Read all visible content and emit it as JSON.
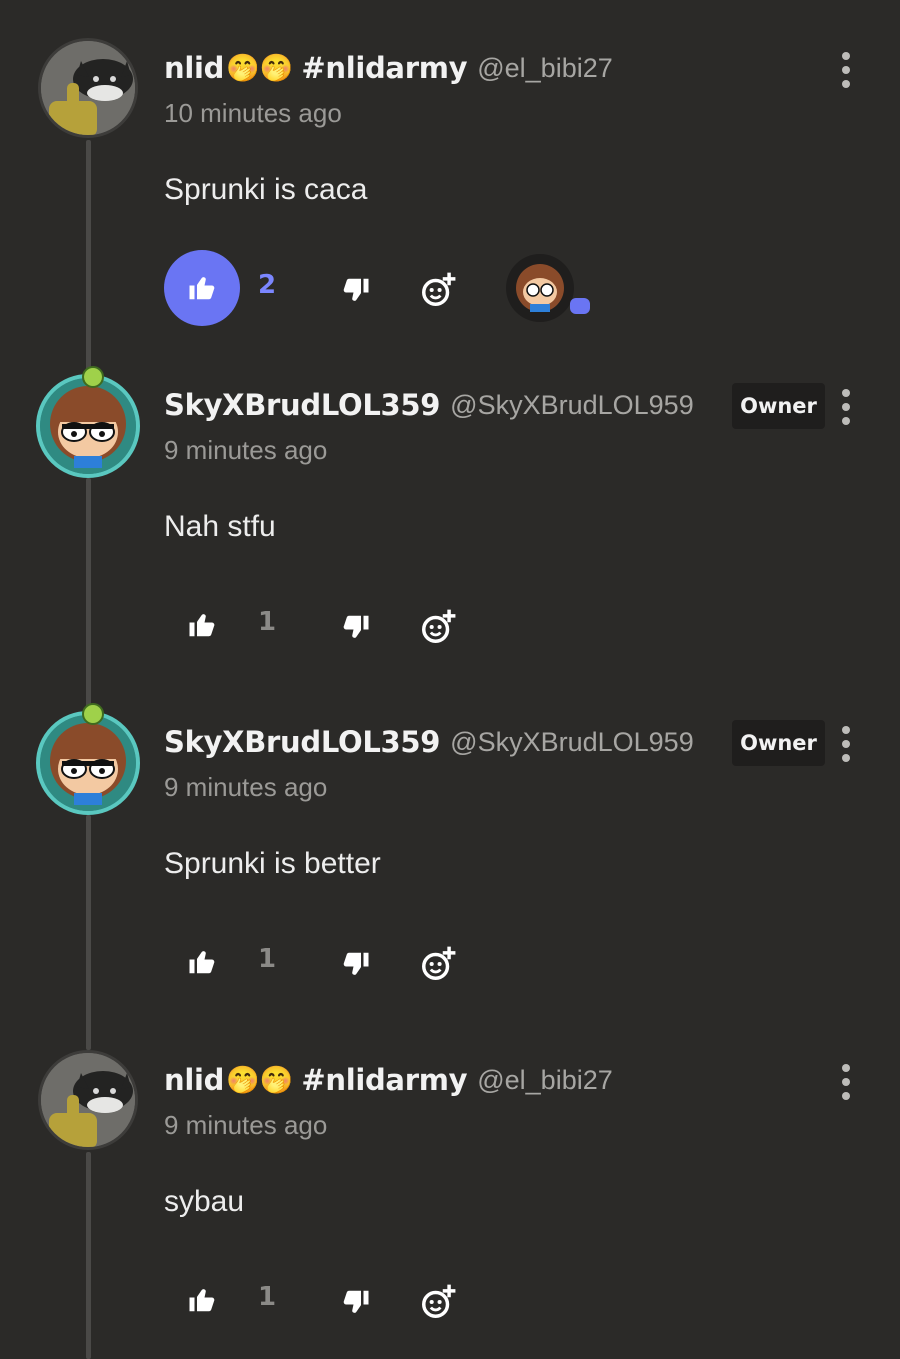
{
  "comments": [
    {
      "display_name": "nlid",
      "emojis": "🤭🤭",
      "tag": "#nlidarmy",
      "handle": "@el_bibi27",
      "time": "10 minutes ago",
      "text": "Sprunki is caca",
      "likes": "2",
      "liked": true,
      "owner": false,
      "avatar": "cat-avatar"
    },
    {
      "display_name": "SkyXBrudLOL359",
      "handle": "@SkyXBrudLOL959",
      "badge": "Owner",
      "time": "9 minutes ago",
      "text": "Nah stfu",
      "likes": "1",
      "liked": false,
      "owner": true,
      "avatar": "character-avatar"
    },
    {
      "display_name": "SkyXBrudLOL359",
      "handle": "@SkyXBrudLOL959",
      "badge": "Owner",
      "time": "9 minutes ago",
      "text": "Sprunki is better",
      "likes": "1",
      "liked": false,
      "owner": true,
      "avatar": "character-avatar"
    },
    {
      "display_name": "nlid",
      "emojis": "🤭🤭",
      "tag": "#nlidarmy",
      "handle": "@el_bibi27",
      "time": "9 minutes ago",
      "text": "sybau",
      "likes": "1",
      "liked": false,
      "owner": false,
      "avatar": "cat-avatar"
    }
  ],
  "icons": {
    "like": "thumbs-up-icon",
    "dislike": "thumbs-down-icon",
    "react": "add-reaction-icon",
    "menu": "more-vertical-icon"
  },
  "colors": {
    "background": "#2b2a28",
    "like_active": "#6a75f3",
    "owner_badge_bg": "#1f1e1d"
  }
}
